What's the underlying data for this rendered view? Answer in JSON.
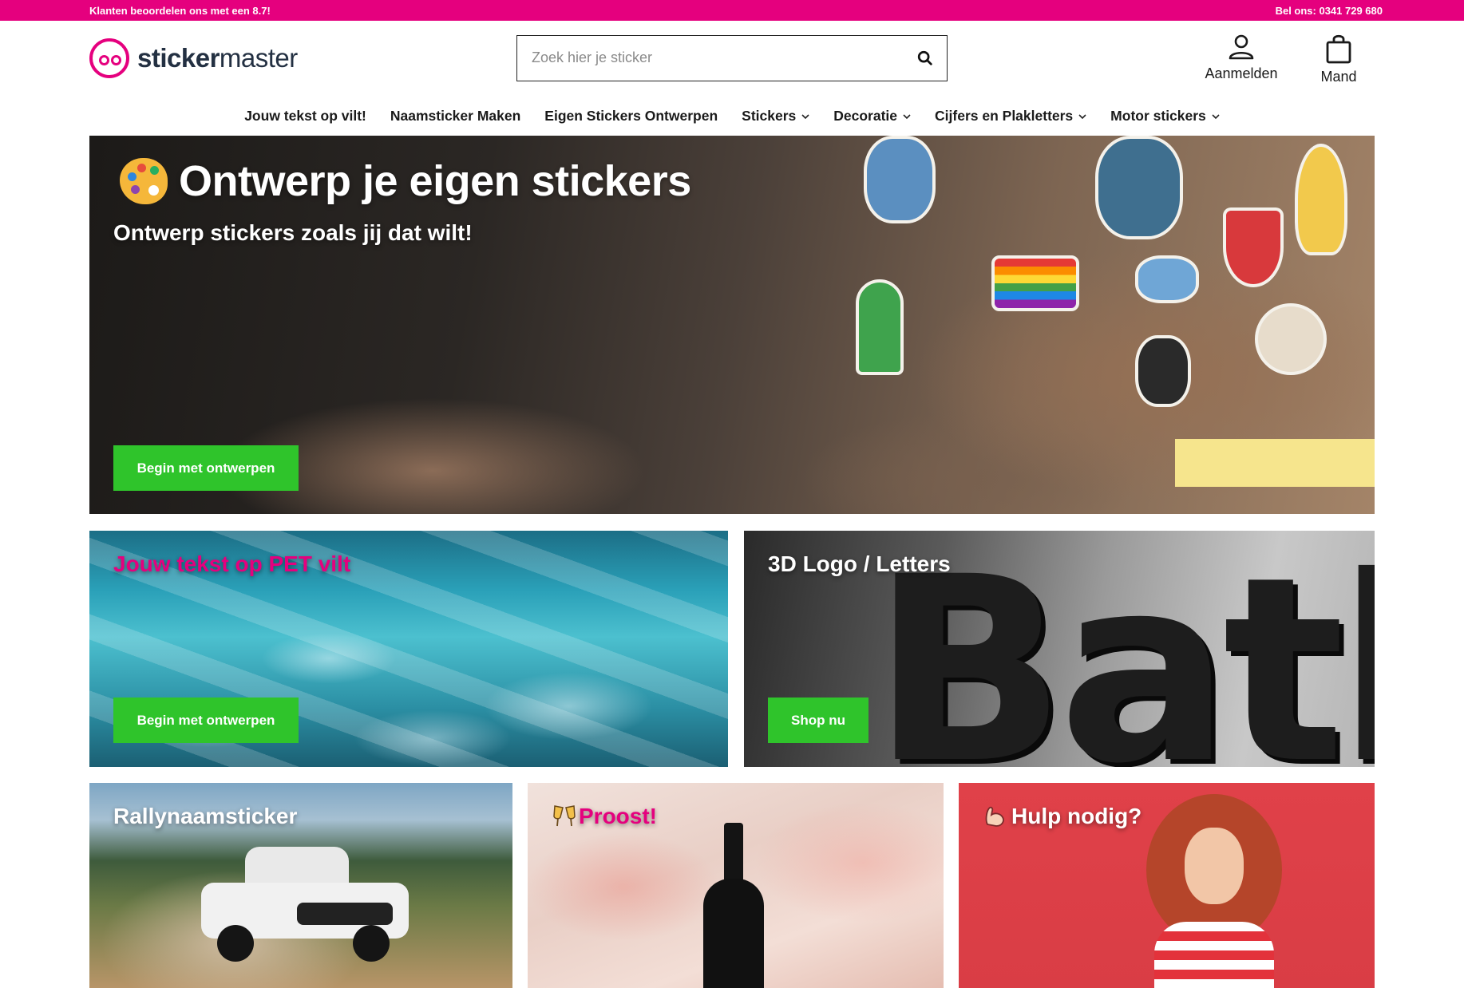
{
  "topbar": {
    "rating_text": "Klanten beoordelen ons met een 8.7!",
    "phone_text": "Bel ons: 0341 729 680"
  },
  "brand": {
    "name_bold": "sticker",
    "name_light": "master",
    "color": "#e5007e"
  },
  "search": {
    "placeholder": "Zoek hier je sticker",
    "value": "",
    "icon": "search-icon"
  },
  "header_actions": {
    "login_label": "Aanmelden",
    "login_icon": "user-icon",
    "cart_label": "Mand",
    "cart_icon": "shopping-bag-icon"
  },
  "nav": {
    "items": [
      {
        "label": "Jouw tekst op vilt!",
        "dropdown": false
      },
      {
        "label": "Naamsticker Maken",
        "dropdown": false
      },
      {
        "label": "Eigen Stickers Ontwerpen",
        "dropdown": false
      },
      {
        "label": "Stickers",
        "dropdown": true
      },
      {
        "label": "Decoratie",
        "dropdown": true
      },
      {
        "label": "Cijfers en Plakletters",
        "dropdown": true
      },
      {
        "label": "Motor stickers",
        "dropdown": true
      }
    ]
  },
  "hero": {
    "icon": "palette-icon",
    "title": "Ontwerp je eigen stickers",
    "subtitle": "Ontwerp stickers zoals jij dat wilt!",
    "button_label": "Begin met ontwerpen"
  },
  "tiles": {
    "pet": {
      "title": "Jouw tekst op PET vilt",
      "title_color": "#e5007e",
      "button_label": "Begin met ontwerpen"
    },
    "logo3d": {
      "title": "3D Logo / Letters",
      "title_color": "#ffffff",
      "button_label": "Shop nu",
      "sign_text": "Bathroo"
    },
    "rally": {
      "title": "Rallynaamsticker",
      "title_color": "#ffffff"
    },
    "proost": {
      "icon": "champagne-glasses-icon",
      "title": "Proost!",
      "title_color": "#e5007e"
    },
    "help": {
      "icon": "flexed-biceps-icon",
      "title": "Hulp nodig?",
      "title_color": "#ffffff"
    }
  },
  "colors": {
    "accent": "#e5007e",
    "cta_green": "#2fc42b",
    "help_red": "#e04149"
  }
}
